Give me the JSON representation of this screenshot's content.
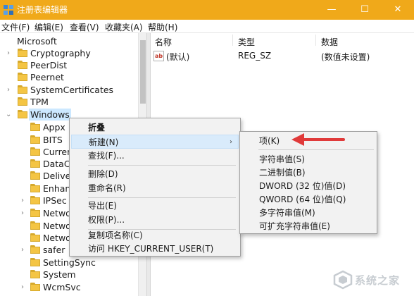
{
  "window": {
    "title": "注册表编辑器",
    "minimize_glyph": "—",
    "maximize_glyph": "☐",
    "close_glyph": "✕",
    "accent": "#f0a91a"
  },
  "menubar": {
    "items": [
      "文件(F)",
      "编辑(E)",
      "查看(V)",
      "收藏夹(A)",
      "帮助(H)"
    ]
  },
  "tree": {
    "rows": [
      {
        "label": "Microsoft",
        "toggle": "⌄"
      },
      {
        "label": "Cryptography",
        "toggle": "›"
      },
      {
        "label": "PeerDist",
        "toggle": ""
      },
      {
        "label": "Peernet",
        "toggle": ""
      },
      {
        "label": "SystemCertificates",
        "toggle": "›"
      },
      {
        "label": "TPM",
        "toggle": ""
      },
      {
        "label": "Windows",
        "toggle": "⌄"
      },
      {
        "label": "Appx",
        "toggle": ""
      },
      {
        "label": "BITS",
        "toggle": ""
      },
      {
        "label": "Curren",
        "toggle": ""
      },
      {
        "label": "DataC",
        "toggle": ""
      },
      {
        "label": "Delive",
        "toggle": ""
      },
      {
        "label": "Enhan",
        "toggle": ""
      },
      {
        "label": "IPSec",
        "toggle": "›"
      },
      {
        "label": "Netwo",
        "toggle": "›"
      },
      {
        "label": "Netwo",
        "toggle": ""
      },
      {
        "label": "Netwo",
        "toggle": ""
      },
      {
        "label": "safer",
        "toggle": "›"
      },
      {
        "label": "SettingSync",
        "toggle": ""
      },
      {
        "label": "System",
        "toggle": ""
      },
      {
        "label": "WcmSvc",
        "toggle": "›"
      }
    ]
  },
  "values_pane": {
    "headers": {
      "name": "名称",
      "type": "类型",
      "data": "数据"
    },
    "rows": [
      {
        "icon": "ab",
        "name": "(默认)",
        "type": "REG_SZ",
        "data": "(数值未设置)"
      }
    ]
  },
  "context_menu": {
    "items": [
      {
        "label": "折叠",
        "bold": true
      },
      {
        "label": "新建(N)",
        "submenu_arrow": "›",
        "highlighted": true
      },
      {
        "label": "查找(F)..."
      },
      {
        "label": "删除(D)"
      },
      {
        "label": "重命名(R)"
      },
      {
        "label": "导出(E)"
      },
      {
        "label": "权限(P)..."
      },
      {
        "label": "复制项名称(C)"
      },
      {
        "label": "访问 HKEY_CURRENT_USER(T)"
      }
    ]
  },
  "submenu": {
    "items": [
      {
        "label": "项(K)"
      },
      {
        "label": "字符串值(S)"
      },
      {
        "label": "二进制值(B)"
      },
      {
        "label": "DWORD (32 位)值(D)"
      },
      {
        "label": "QWORD (64 位)值(Q)"
      },
      {
        "label": "多字符串值(M)"
      },
      {
        "label": "可扩充字符串值(E)"
      }
    ]
  },
  "annotation": {
    "color": "#e03a3a"
  },
  "watermark": {
    "text": "系统之家"
  }
}
